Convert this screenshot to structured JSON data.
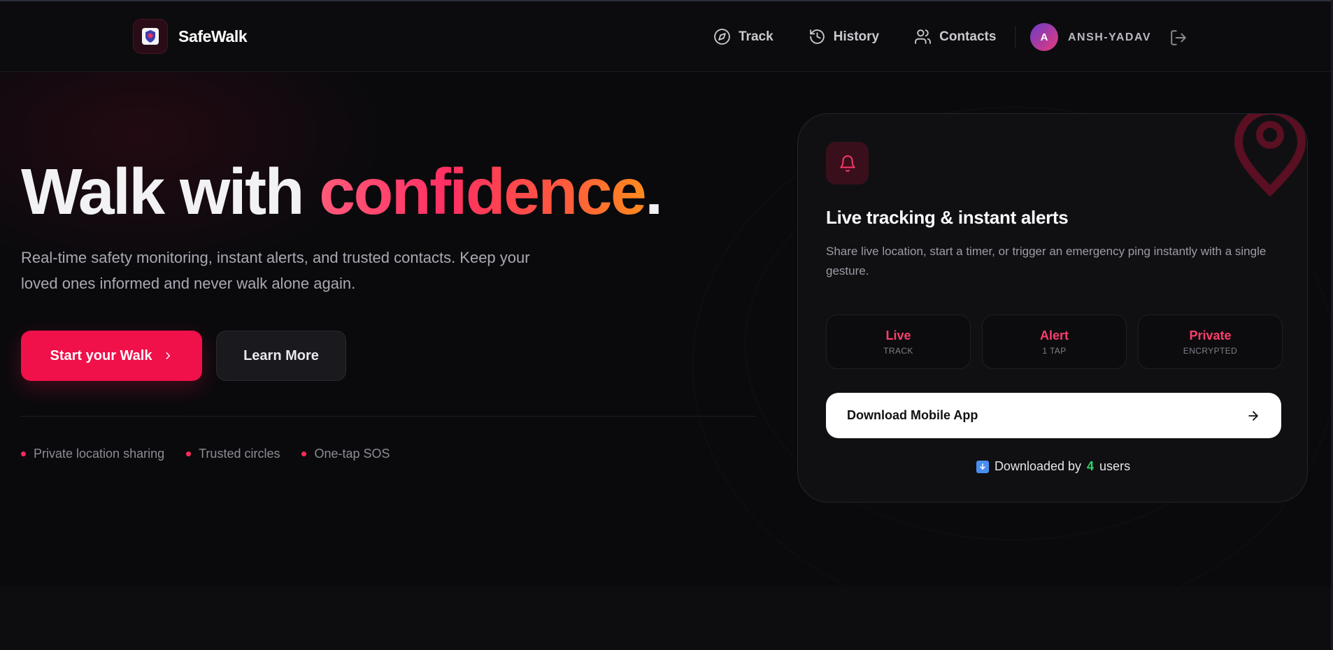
{
  "nav": {
    "brand": "SafeWalk",
    "links": [
      {
        "label": "Track",
        "icon": "compass-icon"
      },
      {
        "label": "History",
        "icon": "history-icon"
      },
      {
        "label": "Contacts",
        "icon": "users-icon"
      }
    ],
    "avatar_initial": "A",
    "username": "ANSH-YADAV"
  },
  "hero": {
    "headline_part1": "Walk with ",
    "headline_accent": "confidence",
    "headline_end": ".",
    "subtext": "Real-time safety monitoring, instant alerts, and trusted contacts. Keep your loved ones informed and never walk alone again.",
    "primary_button": "Start your Walk",
    "secondary_button": "Learn More",
    "features": [
      "Private location sharing",
      "Trusted circles",
      "One-tap SOS"
    ]
  },
  "card": {
    "title": "Live tracking & instant alerts",
    "description": "Share live location, start a timer, or trigger an emergency ping instantly with a single gesture.",
    "stats": [
      {
        "value": "Live",
        "label": "TRACK"
      },
      {
        "value": "Alert",
        "label": "1 TAP"
      },
      {
        "value": "Private",
        "label": "ENCRYPTED"
      }
    ],
    "download_button": "Download Mobile App",
    "downloaded_prefix": "Downloaded by",
    "downloaded_count": "4",
    "downloaded_suffix": "users"
  },
  "colors": {
    "accent": "#f0104a",
    "background": "#0a0a0c",
    "count_green": "#2fd56a"
  }
}
